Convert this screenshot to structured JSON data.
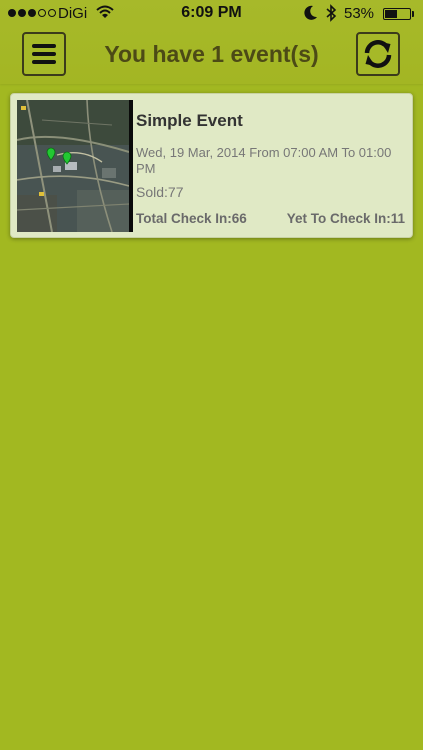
{
  "status_bar": {
    "carrier": "DiGi",
    "time": "6:09 PM",
    "battery_percent": "53%",
    "battery_level": 0.53,
    "signal_bars_filled": 3,
    "signal_bars_total": 5
  },
  "header": {
    "title": "You have 1 event(s)",
    "menu_icon": "hamburger-menu-icon",
    "refresh_icon": "refresh-icon"
  },
  "events": [
    {
      "name": "Simple Event",
      "date_time": "Wed, 19 Mar, 2014 From 07:00 AM To 01:00 PM",
      "sold": "Sold:77",
      "total_check_in": "Total Check In:66",
      "yet_to_check_in": "Yet To Check In:11",
      "thumbnail_icon": "map-thumbnail"
    }
  ],
  "colors": {
    "background": "#a2b821",
    "title_text": "#4c4a16",
    "card_background": "#e0e9c5",
    "map_pin": "#22c832"
  }
}
